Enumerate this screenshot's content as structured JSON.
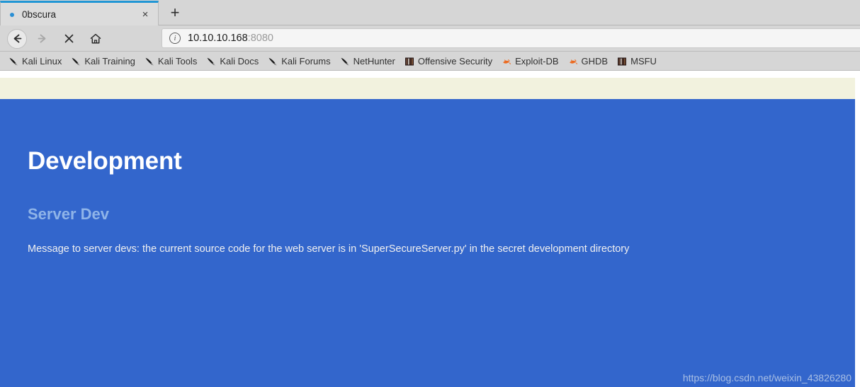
{
  "browser": {
    "tab": {
      "title": "0bscura",
      "favicon_icon": "dot-favicon",
      "close_icon": "close-icon",
      "close_label": "×"
    },
    "newtab": {
      "icon": "plus-icon",
      "label": "+"
    },
    "toolbar": {
      "back_icon": "back-arrow-icon",
      "back_label": "←",
      "forward_icon": "forward-arrow-icon",
      "forward_label": "→",
      "stop_icon": "stop-x-icon",
      "stop_label": "✕",
      "home_icon": "home-icon"
    },
    "urlbar": {
      "info_icon": "info-circle-icon",
      "info_label": "i",
      "host": "10.10.10.168",
      "port": ":8080"
    },
    "bookmarks": [
      {
        "label": "Kali Linux",
        "icon": "kali-dragon-icon"
      },
      {
        "label": "Kali Training",
        "icon": "kali-dragon-icon"
      },
      {
        "label": "Kali Tools",
        "icon": "kali-dragon-icon"
      },
      {
        "label": "Kali Docs",
        "icon": "kali-dragon-icon"
      },
      {
        "label": "Kali Forums",
        "icon": "kali-dragon-icon"
      },
      {
        "label": "NetHunter",
        "icon": "kali-dragon-icon"
      },
      {
        "label": "Offensive Security",
        "icon": "book-icon"
      },
      {
        "label": "Exploit-DB",
        "icon": "orange-splat-icon"
      },
      {
        "label": "GHDB",
        "icon": "orange-splat-icon"
      },
      {
        "label": "MSFU",
        "icon": "book-icon"
      }
    ]
  },
  "page": {
    "heading": "Development",
    "subheading": "Server Dev",
    "message": "Message to server devs: the current source code for the web server is in 'SuperSecureServer.py' in the secret development directory",
    "watermark": "https://blog.csdn.net/weixin_43826280",
    "colors": {
      "body_blue": "#3366cc",
      "band_cream": "#f2f2de",
      "heading_white": "#ffffff",
      "subheading_light_blue": "#8fb4e8",
      "watermark_color": "#a9bfe4"
    }
  }
}
